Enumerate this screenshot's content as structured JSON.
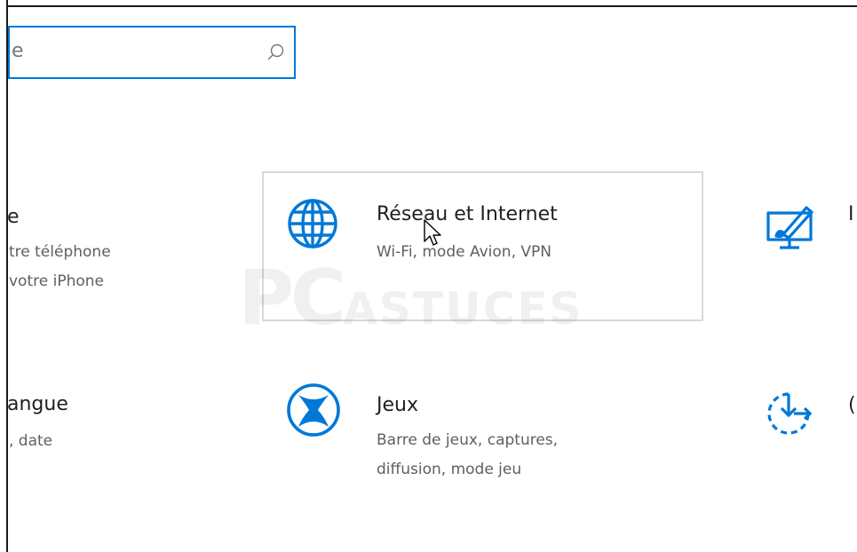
{
  "search": {
    "value": "e"
  },
  "tiles": {
    "left_top": {
      "title": "e",
      "line1": "tre téléphone",
      "line2": "votre iPhone"
    },
    "network": {
      "title": "Réseau et Internet",
      "subtitle": "Wi-Fi, mode Avion, VPN"
    },
    "right_top": {
      "title": "I",
      "subtitle": ""
    },
    "left_bottom": {
      "title": "angue",
      "subtitle": ", date"
    },
    "games": {
      "title": "Jeux",
      "line1": "Barre de jeux, captures,",
      "line2": "diffusion, mode jeu"
    },
    "right_bottom": {
      "title": "("
    }
  },
  "watermark": {
    "big": "PC",
    "small": "ASTUCES"
  },
  "icons": {
    "search": "search-icon",
    "network": "globe-icon",
    "personalization": "paint-display-icon",
    "games": "xbox-icon",
    "update": "update-sync-icon"
  },
  "colors": {
    "accent": "#0078d7"
  }
}
